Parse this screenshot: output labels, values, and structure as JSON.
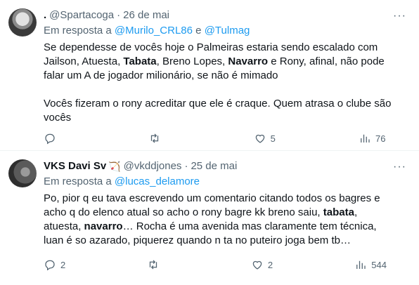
{
  "tweets": [
    {
      "name": ".",
      "handle": "@Spartacoga",
      "separator": "·",
      "date": "26 de mai",
      "reply_prefix": "Em resposta a",
      "reply_mentions": [
        "@Murilo_CRL86",
        "@Tulmag"
      ],
      "reply_join": "e",
      "text_parts": [
        {
          "t": "Se dependesse de vocês hoje o Palmeiras estaria sendo escalado com Jailson, Atuesta, ",
          "b": false
        },
        {
          "t": "Tabata",
          "b": true
        },
        {
          "t": ", Breno Lopes, ",
          "b": false
        },
        {
          "t": "Navarro",
          "b": true
        },
        {
          "t": " e Rony, afinal, não pode falar um A de jogador milionário, se não é mimado",
          "b": false
        }
      ],
      "text_para2": "Vocês fizeram o rony acreditar que ele é craque. Quem atrasa o clube são vocês",
      "replies": "",
      "retweets": "",
      "likes": "5",
      "views": "76"
    },
    {
      "name": "VKS Davi Sv",
      "name_emoji": "🏹",
      "handle": "@vkddjones",
      "separator": "·",
      "date": "25 de mai",
      "reply_prefix": "Em resposta a",
      "reply_mentions": [
        "@lucas_delamore"
      ],
      "text_parts": [
        {
          "t": "Po, pior q eu tava escrevendo um comentario citando todos os bagres e acho q do elenco atual so acho o rony bagre kk breno saiu, ",
          "b": false
        },
        {
          "t": "tabata",
          "b": true
        },
        {
          "t": ", atuesta, ",
          "b": false
        },
        {
          "t": "navarro",
          "b": true
        },
        {
          "t": "… Rocha é uma avenida mas claramente tem técnica, luan é so azarado, piquerez quando n ta no puteiro joga bem tb…",
          "b": false
        }
      ],
      "replies": "2",
      "retweets": "",
      "likes": "2",
      "views": "544"
    }
  ],
  "icons": [
    "reply-icon",
    "retweet-icon",
    "like-icon",
    "views-icon",
    "more-icon"
  ],
  "colors": {
    "text": "#0f1419",
    "muted": "#536471",
    "link": "#1d9bf0",
    "divider": "#eff3f4"
  }
}
